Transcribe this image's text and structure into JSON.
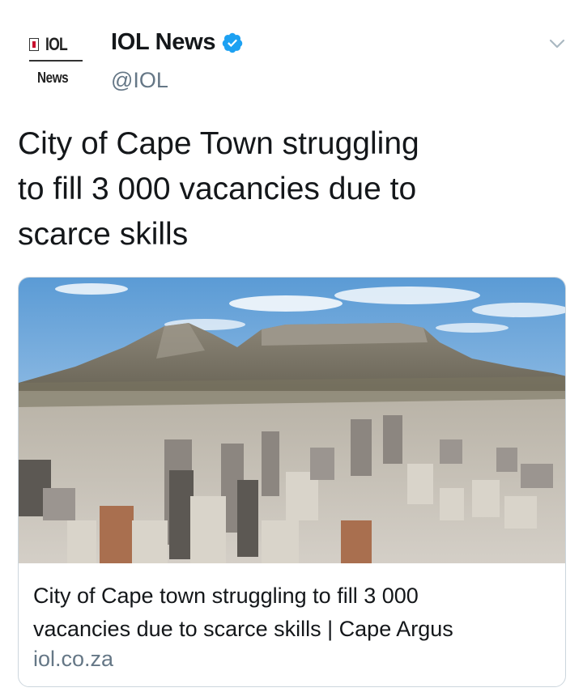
{
  "account": {
    "logo_word": "IOL",
    "logo_sub": "News",
    "display_name": "IOL News",
    "handle": "@IOL"
  },
  "tweet": {
    "text_line_1": "City of Cape Town struggling",
    "text_line_2": "to fill 3 000 vacancies due to",
    "text_line_3": "scarce skills"
  },
  "card": {
    "title_line_1": "City of Cape town struggling to fill 3 000",
    "title_line_2": "vacancies due to scarce skills | Cape Argus",
    "domain": "iol.co.za"
  },
  "icons": {
    "verified": "verified-badge-icon",
    "caret": "chevron-down-icon"
  },
  "colors": {
    "verified_blue": "#1da1f2",
    "secondary_text": "#657786",
    "card_border": "#ccd6dd"
  }
}
